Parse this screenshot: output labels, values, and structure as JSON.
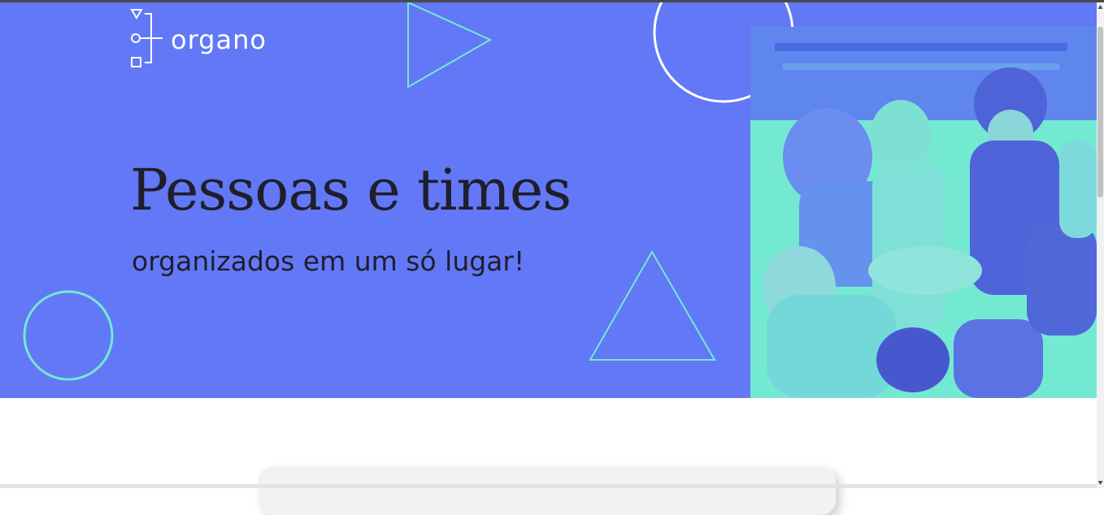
{
  "banner": {
    "logo_text": "organo",
    "headline": "Pessoas e times",
    "subheadline": "organizados em um só lugar!",
    "colors": {
      "background": "#6278f7",
      "accent": "#72ead0",
      "headline_text": "#1f1e2b",
      "logo": "#ffffff"
    },
    "decorations": [
      "triangle-outline",
      "circle-outline",
      "circle-outline",
      "triangle-outline"
    ],
    "photo_icon": "team-hands-together-photo"
  },
  "form_card": {
    "visible": true
  },
  "scrollbar": {
    "up_icon": "arrow-up-icon",
    "down_icon": "arrow-down-icon"
  }
}
